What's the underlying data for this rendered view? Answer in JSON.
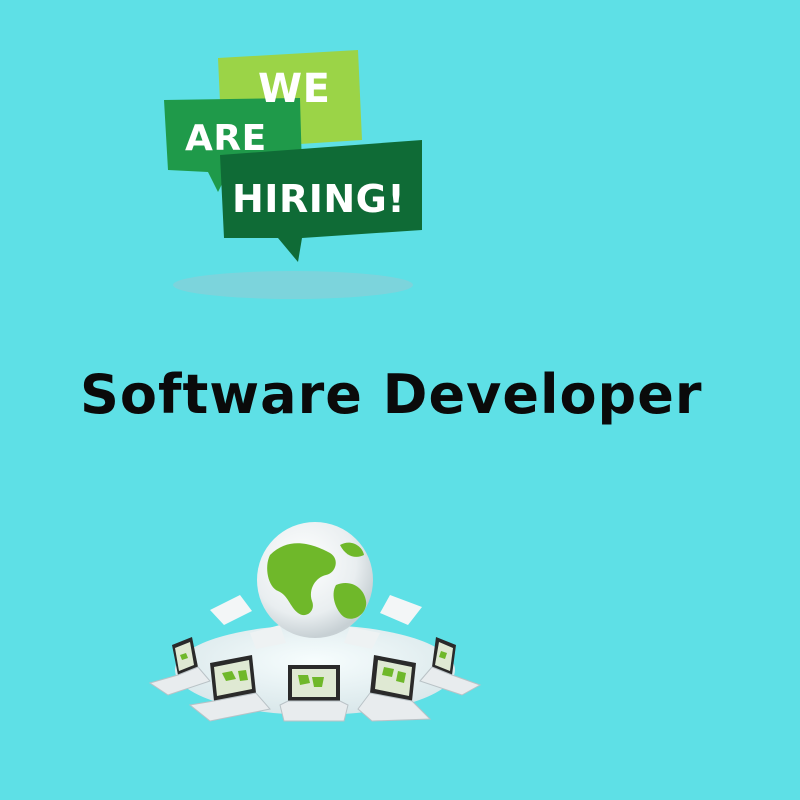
{
  "banner": {
    "line1": "WE",
    "line2": "ARE",
    "line3": "HIRING!"
  },
  "job": {
    "title": "Software Developer"
  },
  "colors": {
    "background": "#5ee0e6",
    "light_green": "#9bd447",
    "mid_green": "#1f9a4a",
    "dark_green": "#0f6b36",
    "title_text": "#0a0a0a"
  },
  "icons": {
    "banner": "speech-bubble-banner",
    "network": "globe-laptop-network-illustration"
  }
}
